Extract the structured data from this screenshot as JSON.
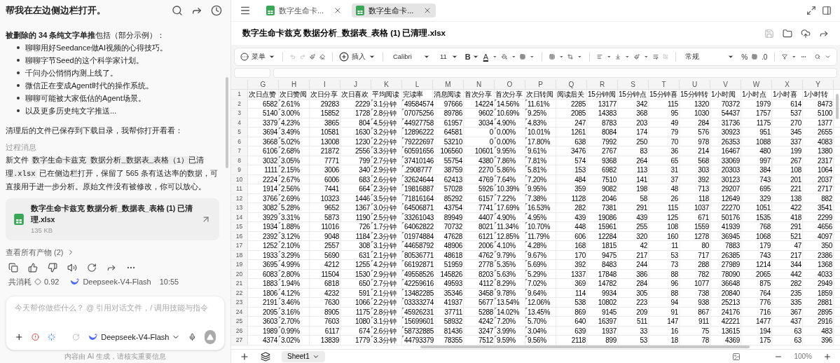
{
  "chat": {
    "title": "帮我在左边侧边栏打开。",
    "intro": "**被删除的 34 条纯文字单推**包括（部分示例）：",
    "bullets": [
      "聊聊用好Seedance做AI视频的心得技巧。",
      "聊聊字节Seed的这个科学家计划。",
      "千问办公悄悄内测上线了。",
      "微信正在变成Agent时代的操作系统。",
      "聊聊可能被大家低估的Agent场景。",
      "以及更多历史纯文字推送..."
    ],
    "saved_note": "清理后的文件已保存到下载目录，我帮你打开看看：",
    "process_label": "过程消息",
    "result": {
      "before": "新文件 ",
      "code": "数字生命卡兹克 数据分析_数据表_表格（1）已清理.xlsx",
      "after": " 已在侧边栏打开，保留了 565 条有送达率的数据，可直接用于进一步分析。原始文件没有被修改，你可以放心。"
    },
    "file": {
      "name": "数字生命卡兹克 数据分析_数据表_表格 (1) 已清理.xlsx",
      "size": "135 KB"
    },
    "artifacts_link": "查看所有产物 (2)",
    "cost_label": "共消耗",
    "cost": "0.92",
    "model": "Deepseek-V4-Flash",
    "time": "10:55",
    "input_placeholder": "今天帮你做些什么？ @ 引用对话文件，/ 调用技能与指令",
    "model_selector": "Deepseek-V4-Flash",
    "disclaimer": "内容由 AI 生成，请核实重要信息"
  },
  "sheet": {
    "tabs": [
      {
        "label": "数字生命卡...",
        "selected": false
      },
      {
        "label": "数字生命卡...",
        "selected": true
      }
    ],
    "title": "数字生命卡兹克 数据分析_数据表_表格 (1) 已清理.xlsx",
    "toolbar": {
      "menu": "菜单",
      "insert": "插入",
      "font": "Calibri",
      "size": "11",
      "bold": "B",
      "font_color": "A",
      "number_format": "常规",
      "percent": "%",
      "decimal": ".0"
    },
    "columns": [
      {
        "letter": "G",
        "kind": "number"
      },
      {
        "letter": "H",
        "kind": "text"
      },
      {
        "letter": "I",
        "kind": "number"
      },
      {
        "letter": "J",
        "kind": "number"
      },
      {
        "letter": "K",
        "kind": "text"
      },
      {
        "letter": "L",
        "kind": "text"
      },
      {
        "letter": "M",
        "kind": "number"
      },
      {
        "letter": "N",
        "kind": "number"
      },
      {
        "letter": "O",
        "kind": "text"
      },
      {
        "letter": "P",
        "kind": "text"
      },
      {
        "letter": "Q",
        "kind": "number"
      },
      {
        "letter": "R",
        "kind": "number"
      },
      {
        "letter": "S",
        "kind": "number"
      },
      {
        "letter": "T",
        "kind": "number"
      },
      {
        "letter": "U",
        "kind": "number"
      },
      {
        "letter": "V",
        "kind": "number"
      },
      {
        "letter": "W",
        "kind": "number"
      },
      {
        "letter": "X",
        "kind": "number"
      },
      {
        "letter": "Y",
        "kind": "number"
      }
    ],
    "rows": [
      {
        "number": "1",
        "kind": "header",
        "cells": [
          "次日点赞",
          "次日赞阅",
          "次日分享",
          "次日喜欢",
          "平均阅读",
          "完读率",
          "消息阅读",
          "首次分享",
          "首次分享",
          "次日转阅",
          "阅读后关",
          "15分钟阅",
          "15分钟点",
          "15分钟喜",
          "15分钟转",
          "1小时阅",
          "1小时点",
          "1小时喜",
          "1小时转"
        ]
      },
      {
        "number": "2",
        "kind": "data",
        "cells": [
          "6582",
          "2.61%",
          "29283",
          "2229",
          "3.1分钟",
          "49584574",
          "97666",
          "14224",
          "14.56%",
          "11.61%",
          "2285",
          "13177",
          "342",
          "115",
          "1320",
          "70372",
          "1979",
          "614",
          "8473"
        ]
      },
      {
        "number": "3",
        "kind": "data",
        "cells": [
          "5140",
          "3.00%",
          "15852",
          "1728",
          "2.8分钟",
          "07075256",
          "89786",
          "9602",
          "10.69%",
          "9.25%",
          "2085",
          "14383",
          "368",
          "95",
          "1030",
          "54437",
          "1757",
          "537",
          "5100"
        ]
      },
      {
        "number": "4",
        "kind": "data",
        "cells": [
          "3379",
          "4.23%",
          "3865",
          "804",
          "4.5分钟",
          "44927758",
          "61957",
          "3034",
          "4.90%",
          "4.83%",
          "247",
          "8783",
          "203",
          "49",
          "284",
          "31736",
          "1175",
          "270",
          "1377"
        ]
      },
      {
        "number": "5",
        "kind": "data",
        "cells": [
          "3694",
          "3.49%",
          "10581",
          "1630",
          "3.2分钟",
          "12896222",
          "64581",
          "0",
          "0.00%",
          "10.01%",
          "1261",
          "8084",
          "174",
          "79",
          "576",
          "30923",
          "951",
          "345",
          "2655"
        ]
      },
      {
        "number": "6",
        "kind": "data",
        "cells": [
          "3668",
          "5.02%",
          "13008",
          "1230",
          "2.2分钟",
          "79222697",
          "53210",
          "0",
          "0.00%",
          "17.80%",
          "638",
          "7992",
          "250",
          "70",
          "978",
          "26353",
          "1088",
          "337",
          "4083"
        ]
      },
      {
        "number": "7",
        "kind": "data",
        "cells": [
          "6106",
          "2.68%",
          "21872",
          "2556",
          "3.3分钟",
          "60591656",
          "106560",
          "10601",
          "9.95%",
          "9.61%",
          "3476",
          "2767",
          "83",
          "36",
          "214",
          "16467",
          "480",
          "199",
          "1380"
        ]
      },
      {
        "number": "8",
        "kind": "data",
        "cells": [
          "3032",
          "3.05%",
          "7771",
          "799",
          "2.7分钟",
          "37410146",
          "55754",
          "4380",
          "7.86%",
          "7.81%",
          "574",
          "9368",
          "264",
          "65",
          "568",
          "33069",
          "997",
          "267",
          "2317"
        ]
      },
      {
        "number": "9",
        "kind": "data",
        "cells": [
          "1111",
          "2.15%",
          "3006",
          "340",
          "2.9分钟",
          ".2908777",
          "38759",
          "2270",
          "5.86%",
          "5.81%",
          "153",
          "6982",
          "113",
          "31",
          "303",
          "20303",
          "384",
          "108",
          "1064"
        ]
      },
      {
        "number": "10",
        "kind": "data",
        "cells": [
          "2224",
          "2.67%",
          "6006",
          "683",
          "2.6分钟",
          "32624644",
          "62413",
          "4769",
          "7.64%",
          "7.20%",
          "484",
          "7510",
          "141",
          "37",
          "392",
          "30123",
          "743",
          "201",
          "2037"
        ]
      },
      {
        "number": "11",
        "kind": "data",
        "cells": [
          "1914",
          "2.56%",
          "7441",
          "664",
          "2.3分钟",
          "19816887",
          "57028",
          "5926",
          "10.39%",
          "9.95%",
          "359",
          "9082",
          "198",
          "48",
          "713",
          "29207",
          "695",
          "221",
          "2717"
        ]
      },
      {
        "number": "12",
        "kind": "data",
        "cells": [
          "3766",
          "2.69%",
          "10323",
          "1446",
          "3.5分钟",
          "71816164",
          "85292",
          "6157",
          "7.22%",
          "7.38%",
          "1128",
          "2046",
          "58",
          "26",
          "118",
          "12649",
          "329",
          "138",
          "882"
        ]
      },
      {
        "number": "13",
        "kind": "data",
        "cells": [
          "3082",
          "5.28%",
          "9652",
          "1367",
          "3.0分钟",
          "64506871",
          "43754",
          "7741",
          "17.69%",
          "16.53%",
          "282",
          "7381",
          "291",
          "115",
          "1037",
          "22270",
          "1051",
          "422",
          "3541"
        ]
      },
      {
        "number": "14",
        "kind": "data",
        "cells": [
          "3929",
          "3.31%",
          "5873",
          "1190",
          "2.5分钟",
          "33261043",
          "89949",
          "4407",
          "4.90%",
          "4.95%",
          "439",
          "19086",
          "439",
          "125",
          "671",
          "50176",
          "1535",
          "418",
          "2299"
        ]
      },
      {
        "number": "15",
        "kind": "data",
        "cells": [
          "1934",
          "1.88%",
          "11016",
          "726",
          "1.7分钟",
          "64062822",
          "70732",
          "8021",
          "11.34%",
          "10.70%",
          "448",
          "15961",
          "255",
          "108",
          "1559",
          "41939",
          "768",
          "291",
          "4656"
        ]
      },
      {
        "number": "16",
        "kind": "data",
        "cells": [
          "2392",
          "3.12%",
          "9048",
          "1184",
          "2.3分钟",
          "01974884",
          "47628",
          "6121",
          "12.85%",
          "11.79%",
          "606",
          "12284",
          "320",
          "160",
          "1278",
          "36945",
          "1068",
          "521",
          "4097"
        ]
      },
      {
        "number": "17",
        "kind": "data",
        "cells": [
          "1252",
          "2.10%",
          "2557",
          "308",
          "3.1分钟",
          "44658792",
          "48906",
          "2006",
          "4.10%",
          "4.28%",
          "168",
          "1815",
          "42",
          "11",
          "80",
          "7883",
          "179",
          "47",
          "350"
        ]
      },
      {
        "number": "18",
        "kind": "data",
        "cells": [
          "1933",
          "3.29%",
          "5690",
          "631",
          "2.1分钟",
          "80536771",
          "48618",
          "4762",
          "9.79%",
          "9.67%",
          "170",
          "9475",
          "217",
          "53",
          "717",
          "26385",
          "743",
          "217",
          "2386"
        ]
      },
      {
        "number": "19",
        "kind": "data",
        "cells": [
          "3695",
          "4.99%",
          "4212",
          "1255",
          "4.2分钟",
          "66192871",
          "51959",
          "2778",
          "5.35%",
          "5.69%",
          "392",
          "8483",
          "244",
          "73",
          "288",
          "27989",
          "1214",
          "344",
          "1368"
        ]
      },
      {
        "number": "20",
        "kind": "data",
        "cells": [
          "6083",
          "2.80%",
          "11504",
          "1530",
          "2.9分钟",
          "49558526",
          "145826",
          "8203",
          "5.63%",
          "5.29%",
          "1337",
          "17848",
          "386",
          "88",
          "782",
          "78090",
          "2065",
          "442",
          "4033"
        ]
      },
      {
        "number": "21",
        "kind": "data",
        "cells": [
          "1883",
          "1.94%",
          "6818",
          "650",
          "2.7分钟",
          "42259616",
          "49593",
          "4112",
          "8.29%",
          "7.02%",
          "369",
          "14782",
          "284",
          "96",
          "1077",
          "36648",
          "875",
          "282",
          "2949"
        ]
      },
      {
        "number": "22",
        "kind": "data",
        "cells": [
          "1806",
          "4.12%",
          "4232",
          "591",
          "2.1分钟",
          "13482285",
          "35346",
          "3458",
          "9.78%",
          "9.64%",
          "114",
          "9934",
          "305",
          "88",
          "738",
          "20840",
          "764",
          "235",
          "1859"
        ]
      },
      {
        "number": "23",
        "kind": "data",
        "cells": [
          "2191",
          "3.46%",
          "7630",
          "1066",
          "2.2分钟",
          "03333274",
          "41937",
          "5677",
          "13.54%",
          "12.06%",
          "538",
          "10802",
          "223",
          "94",
          "938",
          "25213",
          "776",
          "335",
          "2881"
        ]
      },
      {
        "number": "24",
        "kind": "data",
        "cells": [
          "2095",
          "3.16%",
          "8905",
          "1175",
          "2.8分钟",
          "45926231",
          "37711",
          "5288",
          "14.02%",
          "13.45%",
          "869",
          "9145",
          "209",
          "91",
          "867",
          "24176",
          "716",
          "367",
          "2895"
        ]
      },
      {
        "number": "25",
        "kind": "data",
        "cells": [
          "3603",
          "2.70%",
          "7603",
          "1080",
          "3.1分钟",
          "15699601",
          "58932",
          "4242",
          "7.20%",
          "5.70%",
          "640",
          "16397",
          "511",
          "147",
          "911",
          "42221",
          "1477",
          "437",
          "2916"
        ]
      },
      {
        "number": "26",
        "kind": "data",
        "cells": [
          "1989",
          "0.99%",
          "6117",
          "674",
          "2.6分钟",
          "58732885",
          "81436",
          "3247",
          "3.99%",
          "3.04%",
          "639",
          "1937",
          "33",
          "16",
          "75",
          "13615",
          "194",
          "63",
          "483"
        ]
      },
      {
        "number": "27",
        "kind": "data",
        "cells": [
          "4374",
          "3.02%",
          "13839",
          "1779",
          "3.3分钟",
          "44793379",
          "78355",
          "7512",
          "9.59%",
          "9.56%",
          "2118",
          "899",
          "53",
          "18",
          "78",
          "4369",
          "175",
          "63",
          "396"
        ]
      }
    ],
    "sheet_tabs": [
      {
        "label": "Sheet1",
        "selected": true
      }
    ],
    "zoom": "100%"
  }
}
